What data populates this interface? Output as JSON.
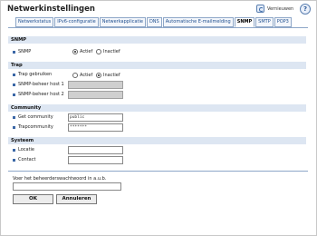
{
  "title": "Netwerkinstellingen",
  "header": {
    "refresh_label": "Vernieuwen",
    "help_symbol": "?"
  },
  "tabs": [
    "Netwerkstatus",
    "IPv6-configuratie",
    "Netwerkapplicatie",
    "DNS",
    "Automatische E-mailmelding",
    "SNMP",
    "SMTP",
    "POP3"
  ],
  "active_tab": "SNMP",
  "snmp": {
    "heading": "SNMP",
    "label": "SNMP",
    "options": [
      "Actief",
      "Inactief"
    ],
    "selected": "Actief"
  },
  "trap": {
    "heading": "Trap",
    "label": "Trap gebruiken",
    "options": [
      "Actief",
      "Inactief"
    ],
    "selected": "Inactief",
    "host1_label": "SNMP-beheer host 1",
    "host2_label": "SNMP-beheer host 2"
  },
  "community": {
    "heading": "Community",
    "get_label": "Get community",
    "get_value": "public",
    "trap_label": "Trapcommunity",
    "trap_value": "*******"
  },
  "system": {
    "heading": "Systeem",
    "location_label": "Locatie",
    "contact_label": "Contact"
  },
  "password": {
    "label": "Voer het beheerderswachtwoord in a.u.b."
  },
  "buttons": {
    "ok": "OK",
    "cancel": "Annuleren"
  }
}
